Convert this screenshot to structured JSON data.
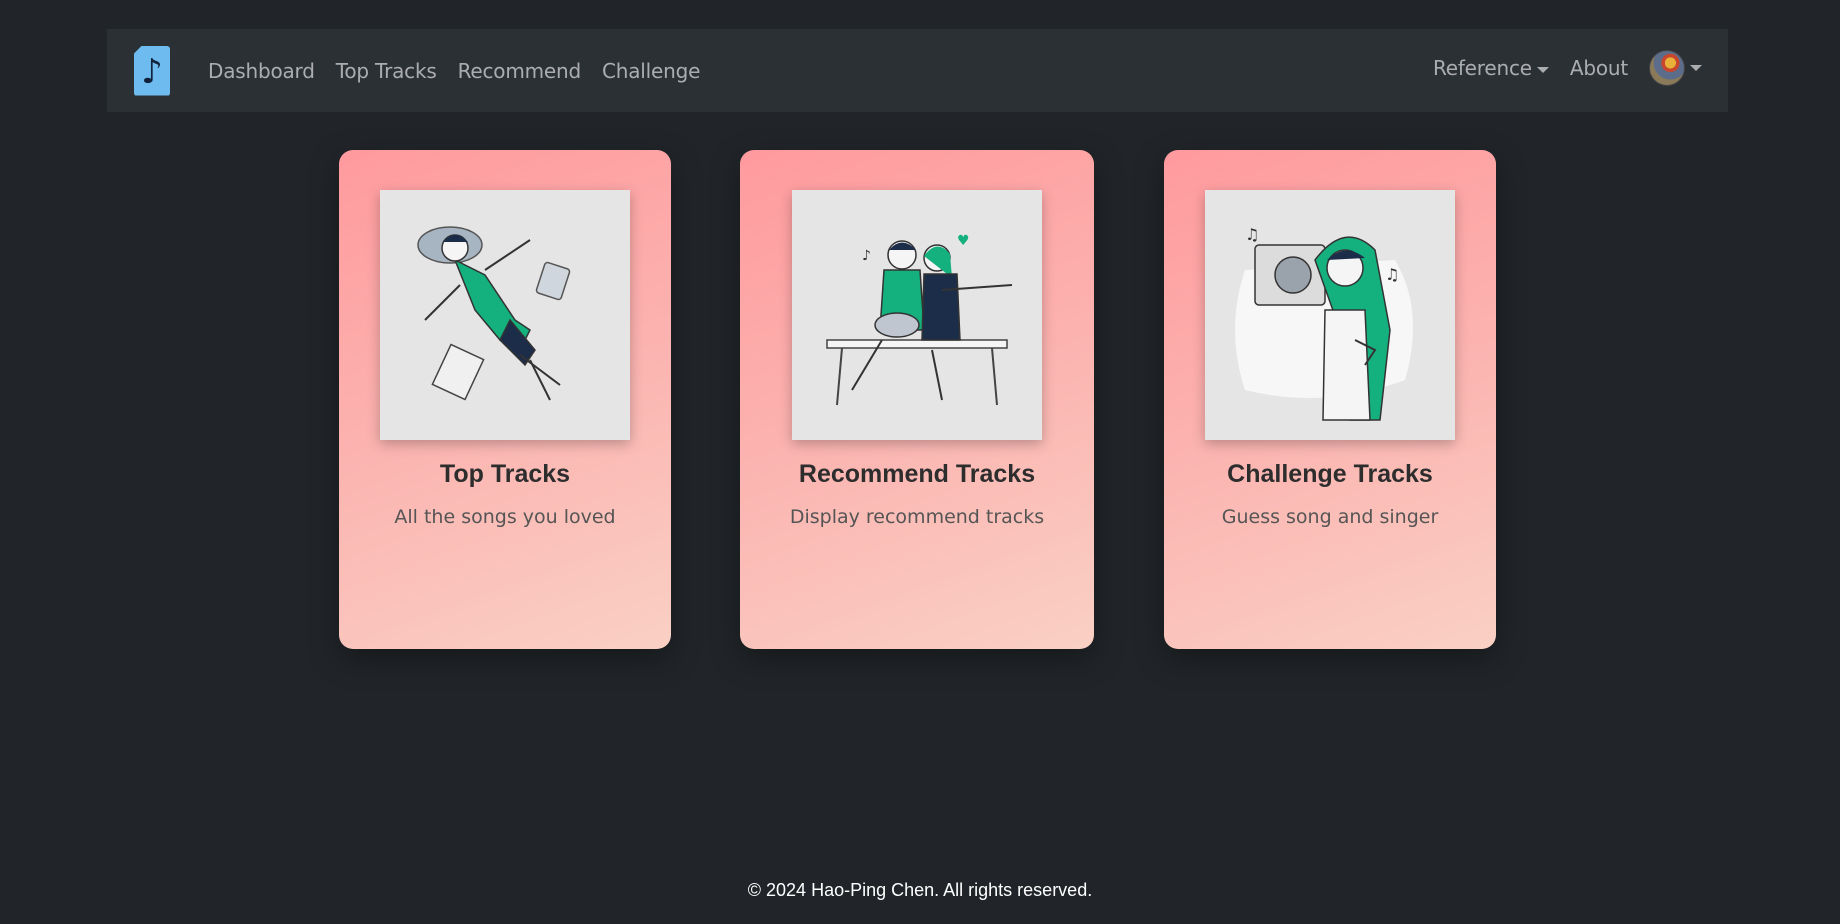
{
  "nav": {
    "brand_icon": "music-note-icon",
    "links": [
      "Dashboard",
      "Top Tracks",
      "Recommend",
      "Challenge"
    ],
    "reference": "Reference",
    "about": "About"
  },
  "cards": [
    {
      "title": "Top Tracks",
      "subtitle": "All the songs you loved"
    },
    {
      "title": "Recommend Tracks",
      "subtitle": "Display recommend tracks"
    },
    {
      "title": "Challenge Tracks",
      "subtitle": "Guess song and singer"
    }
  ],
  "footer": "© 2024 Hao-Ping Chen. All rights reserved.",
  "colors": {
    "background": "#212529",
    "navbar": "#2b3035",
    "card_gradient_start": "#ff9a9e",
    "card_gradient_end": "#fad0c4",
    "illustration_accent": "#14b07e"
  }
}
